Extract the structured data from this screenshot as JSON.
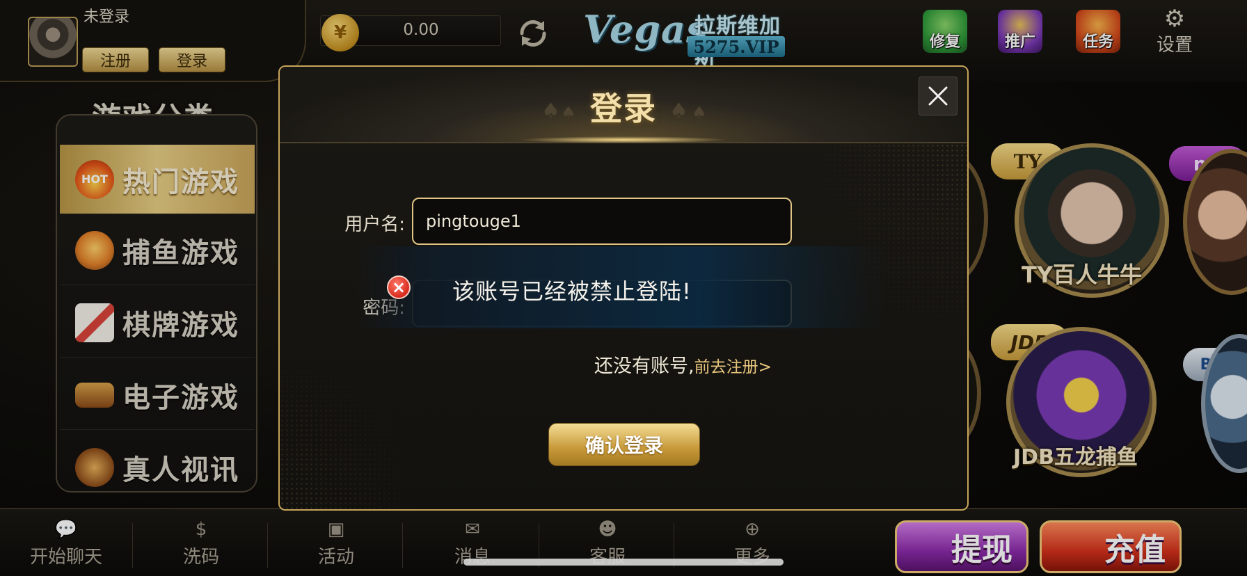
{
  "header": {
    "user_status": "未登录",
    "register_label": "注册",
    "login_label": "登录",
    "currency_symbol": "¥",
    "balance": "0.00",
    "logo": {
      "brand": "Vegas",
      "name_cn": "拉斯维加斯",
      "domain": "5275.VIP"
    },
    "icons": [
      {
        "label": "修复",
        "icon": "repair-icon",
        "color": "#2f9a3a"
      },
      {
        "label": "推广",
        "icon": "promote-icon",
        "color": "#7a3ab5"
      },
      {
        "label": "任务",
        "icon": "task-icon",
        "color": "#d24a1c"
      }
    ],
    "settings_label": "设置"
  },
  "sidebar": {
    "title": "游戏分类",
    "items": [
      {
        "label": "热门游戏",
        "icon": "hot-fire-icon",
        "icon_text": "HOT",
        "active": true
      },
      {
        "label": "捕鱼游戏",
        "icon": "fish-icon",
        "active": false
      },
      {
        "label": "棋牌游戏",
        "icon": "cards-icon",
        "active": false
      },
      {
        "label": "电子游戏",
        "icon": "slot-machine-icon",
        "active": false
      },
      {
        "label": "真人视讯",
        "icon": "live-casino-icon",
        "active": false
      }
    ]
  },
  "games": {
    "ty": {
      "badge": "TY",
      "label": "TY百人牛牛"
    },
    "jdb": {
      "badge": "JDB",
      "label": "JDB五龙捕鱼"
    },
    "mt_badge": "mt",
    "bg_badge": "BG"
  },
  "footer": {
    "items": [
      {
        "label": "开始聊天",
        "icon": "chat-icon"
      },
      {
        "label": "洗码",
        "icon": "rebate-coin-icon"
      },
      {
        "label": "活动",
        "icon": "gift-icon"
      },
      {
        "label": "消息",
        "icon": "mail-icon"
      },
      {
        "label": "客服",
        "icon": "support-agent-icon"
      },
      {
        "label": "更多",
        "icon": "plus-circle-icon"
      }
    ],
    "withdraw_label": "提现",
    "deposit_label": "充值"
  },
  "login_modal": {
    "title": "登录",
    "username_label": "用户名:",
    "username_value": "pingtouge1",
    "password_label": "密码:",
    "password_value": "",
    "no_account_text": "还没有账号,",
    "register_link": "前去注册>",
    "confirm_label": "确认登录"
  },
  "toast": {
    "message": "该账号已经被禁止登陆!"
  },
  "colors": {
    "gold_accent": "#c6a45a",
    "error_red": "#d82a1c",
    "toast_blue": "#0c2a42"
  }
}
